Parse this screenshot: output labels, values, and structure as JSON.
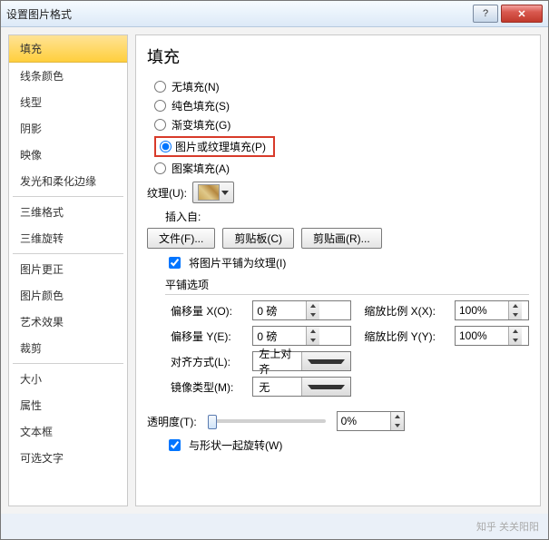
{
  "window": {
    "title": "设置图片格式"
  },
  "sidebar": {
    "items": [
      "填充",
      "线条颜色",
      "线型",
      "阴影",
      "映像",
      "发光和柔化边缘",
      "三维格式",
      "三维旋转",
      "图片更正",
      "图片颜色",
      "艺术效果",
      "裁剪",
      "大小",
      "属性",
      "文本框",
      "可选文字"
    ],
    "separators_after": [
      5,
      7,
      11
    ]
  },
  "content": {
    "heading": "填充",
    "radios": {
      "none": "无填充(N)",
      "solid": "纯色填充(S)",
      "gradient": "渐变填充(G)",
      "picture": "图片或纹理填充(P)",
      "pattern": "图案填充(A)"
    },
    "texture_label": "纹理(U):",
    "insert_from": "插入自:",
    "buttons": {
      "file": "文件(F)...",
      "clipboard": "剪贴板(C)",
      "clipart": "剪贴画(R)..."
    },
    "tile_checkbox": "将图片平铺为纹理(I)",
    "tile_group": "平铺选项",
    "offset_x_label": "偏移量 X(O):",
    "offset_y_label": "偏移量 Y(E):",
    "scale_x_label": "缩放比例 X(X):",
    "scale_y_label": "缩放比例 Y(Y):",
    "offset_x_value": "0 磅",
    "offset_y_value": "0 磅",
    "scale_x_value": "100%",
    "scale_y_value": "100%",
    "align_label": "对齐方式(L):",
    "align_value": "左上对齐",
    "mirror_label": "镜像类型(M):",
    "mirror_value": "无",
    "transparency_label": "透明度(T):",
    "transparency_value": "0%",
    "rotate_with_shape": "与形状一起旋转(W)"
  },
  "footer": "知乎 关关阳阳"
}
